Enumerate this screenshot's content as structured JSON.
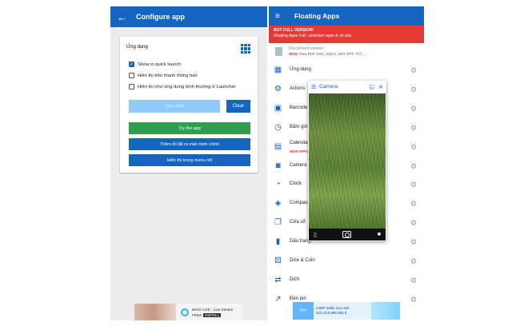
{
  "left": {
    "title": "Configure app",
    "app_name": "Ứng dụng",
    "options": [
      {
        "label": "Show in quick launch",
        "checked": true
      },
      {
        "label": "Hiển thị trên thanh thông báo",
        "checked": false
      },
      {
        "label": "Hiển thị như ứng dụng bình thường ở Launcher",
        "checked": false
      }
    ],
    "icon_color_label": "Icon color",
    "clear_label": "Clear",
    "try_label": "Try the app",
    "add_shortcut_label": "Thêm lối tắt ra màn hình chính",
    "show_menu_label": "Hiển thị trong menu nổi",
    "ad": {
      "title": "BIGO LIVE - Live Stream",
      "free": "FREE",
      "install": "INSTALL"
    }
  },
  "right": {
    "title": "Floating Apps",
    "promo_title": "BUY FULL VERSION!",
    "promo_sub": "Floating Apps Full - premium apps & no ads.",
    "doc_title": "Document viewer",
    "doc_new": "NEW!",
    "doc_formats": "View PDF, DOC, DOCX, ODT, RTF, TXT, ...",
    "apps": [
      {
        "label": "Ứng dụng",
        "icon": "grid-icon",
        "glyph": "▦"
      },
      {
        "label": "Actions",
        "icon": "actions-icon",
        "glyph": "⚙"
      },
      {
        "label": "Barcode",
        "icon": "barcode-icon",
        "glyph": "▣"
      },
      {
        "label": "Bấm giờ",
        "icon": "stopwatch-icon",
        "glyph": "◷"
      },
      {
        "label": "Calendar",
        "icon": "calendar-icon",
        "glyph": "▤",
        "sub": "NEW APPS!"
      },
      {
        "label": "Camera",
        "icon": "camera-icon",
        "glyph": "◙"
      },
      {
        "label": "Clock",
        "icon": "clock-icon",
        "glyph": "◔"
      },
      {
        "label": "Compass",
        "icon": "compass-icon",
        "glyph": "◈"
      },
      {
        "label": "Cửa sổ",
        "icon": "window-icon",
        "glyph": "❐"
      },
      {
        "label": "Dấu trang",
        "icon": "bookmark-icon",
        "glyph": "▮"
      },
      {
        "label": "Dice & Coin",
        "icon": "dice-icon",
        "glyph": "⚄"
      },
      {
        "label": "Dịch",
        "icon": "translate-icon",
        "glyph": "⇄"
      },
      {
        "label": "Đèn pin",
        "icon": "flashlight-icon",
        "glyph": "↗"
      }
    ],
    "camera_window": {
      "title": "Camera"
    },
    "ad": {
      "brand": "V7+",
      "line1": "24MP Selfie Cực Nét",
      "line2": "Giá chỉ 5.990.000 đ"
    }
  },
  "colors": {
    "primary": "#1565c0",
    "try_button": "#2e9e4f",
    "promo": "#e53935"
  }
}
